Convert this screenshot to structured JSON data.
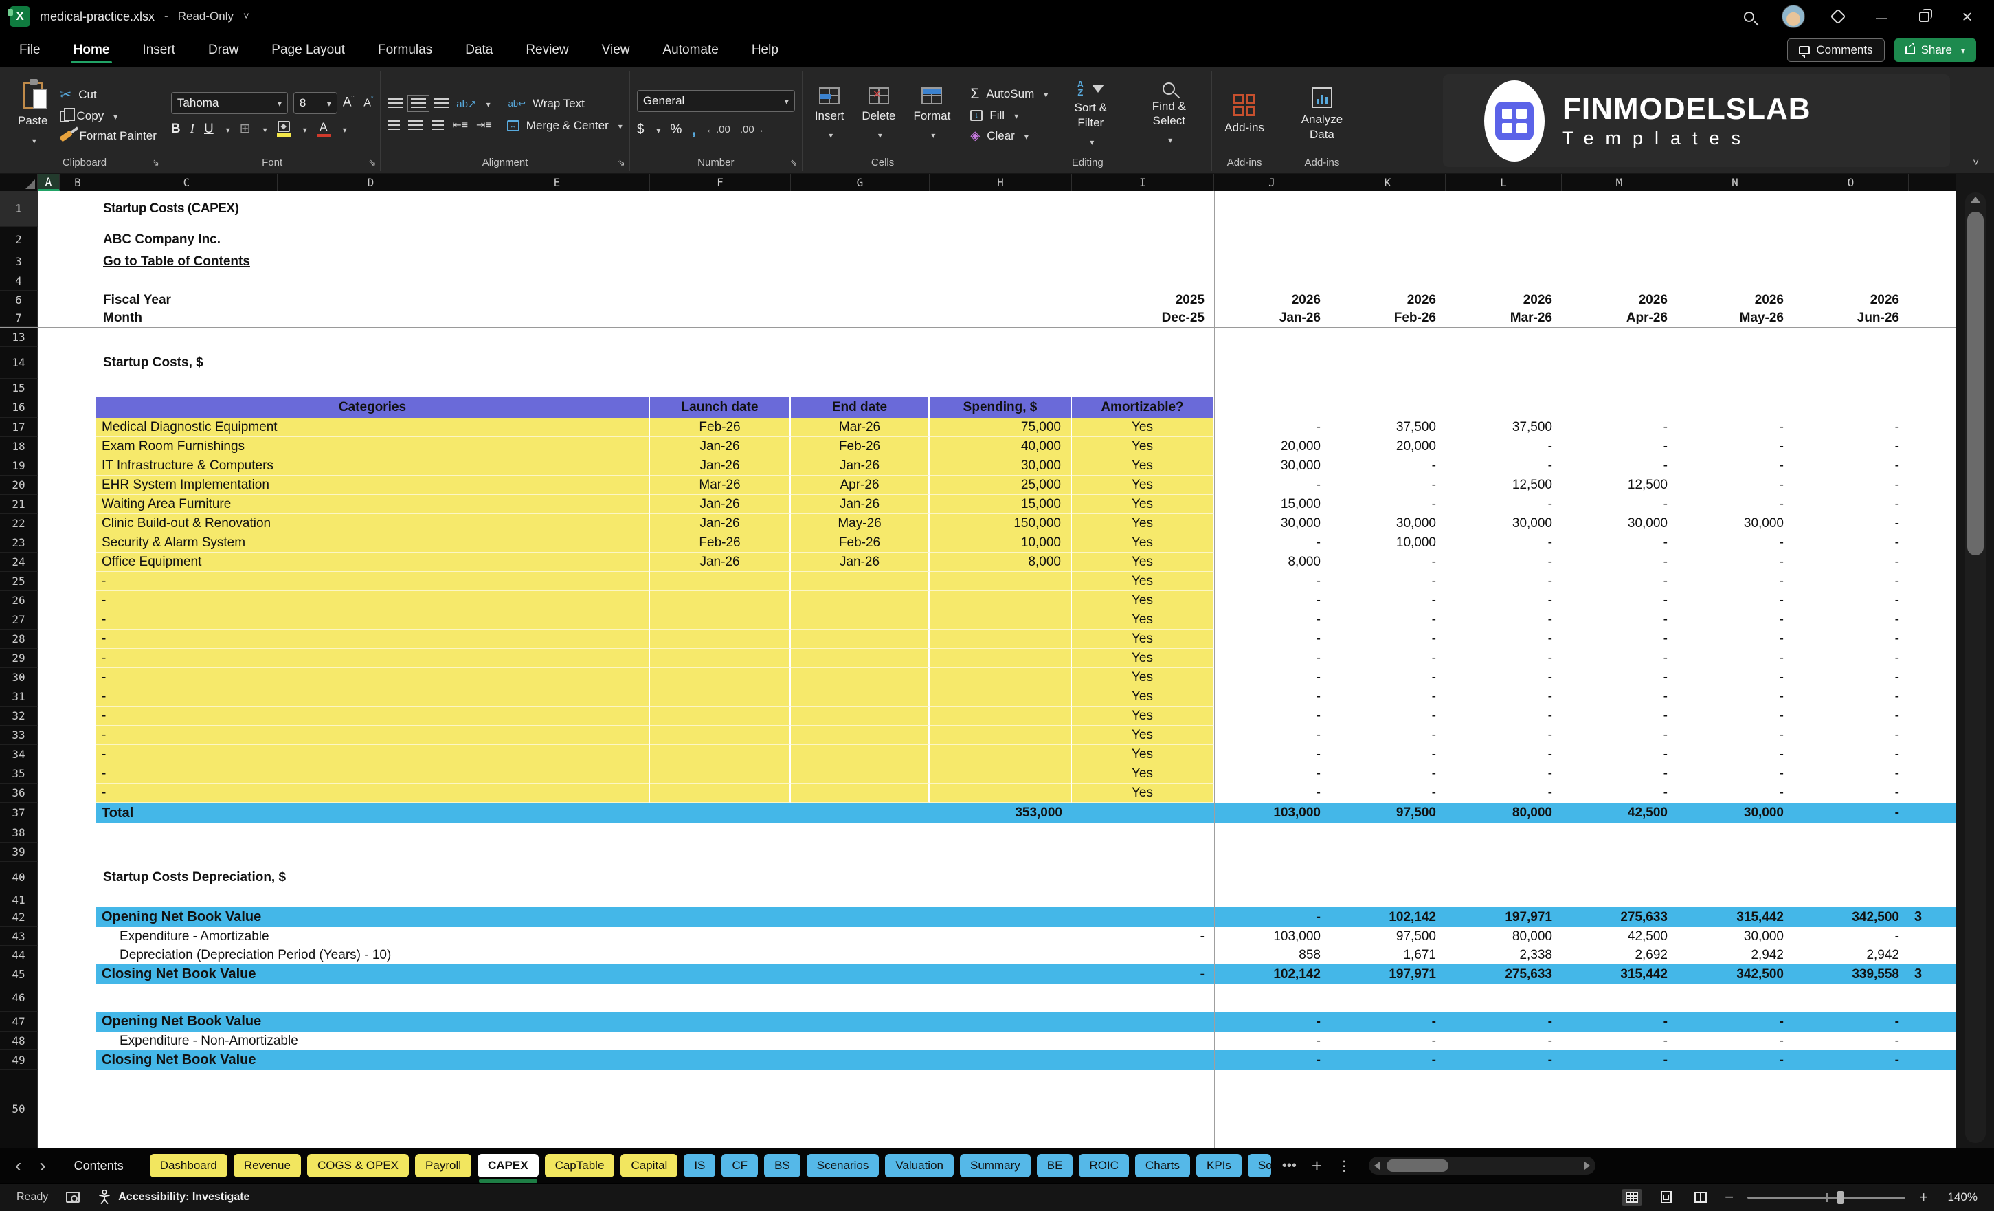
{
  "titlebar": {
    "filename": "medical-practice.xlsx",
    "separator": "-",
    "mode": "Read-Only"
  },
  "menubar": {
    "tabs": [
      "File",
      "Home",
      "Insert",
      "Draw",
      "Page Layout",
      "Formulas",
      "Data",
      "Review",
      "View",
      "Automate",
      "Help"
    ],
    "active_tab": "Home",
    "comments_label": "Comments",
    "share_label": "Share"
  },
  "ribbon": {
    "clipboard": {
      "label": "Clipboard",
      "paste": "Paste",
      "cut": "Cut",
      "copy": "Copy",
      "format_painter": "Format Painter"
    },
    "font": {
      "label": "Font",
      "font_name": "Tahoma",
      "font_size": "8",
      "bold": "B",
      "italic": "I",
      "underline": "U",
      "grow": "A",
      "shrink": "A"
    },
    "alignment": {
      "label": "Alignment",
      "orientation": "ab",
      "wrap_text": "Wrap Text",
      "merge_center": "Merge & Center"
    },
    "number": {
      "label": "Number",
      "format": "General",
      "currency": "$",
      "percent": "%",
      "comma": ",",
      "inc_decimal": "←.00",
      "dec_decimal": ".00→"
    },
    "cells": {
      "label": "Cells",
      "insert": "Insert",
      "delete": "Delete",
      "format": "Format"
    },
    "editing": {
      "label": "Editing",
      "autosum": "AutoSum",
      "sigma": "Σ",
      "fill": "Fill",
      "fill_arrow": "↓",
      "clear": "Clear",
      "clear_icon": "◈",
      "sort_a": "A",
      "sort_z": "Z",
      "sort_filter": "Sort & Filter",
      "find_select": "Find & Select"
    },
    "addins_group_label": "Add-ins",
    "addins": "Add-ins",
    "analyze_data": "Analyze Data",
    "logo": {
      "title": "FINMODELSLAB",
      "subtitle": "Templates"
    }
  },
  "sheet": {
    "column_letters": [
      "A",
      "B",
      "C",
      "D",
      "E",
      "F",
      "G",
      "H",
      "I",
      "J",
      "K",
      "L",
      "M",
      "N",
      "O"
    ],
    "row_numbers": [
      "1",
      "2",
      "3",
      "4",
      "6",
      "7",
      "13",
      "14",
      "15",
      "16",
      "17",
      "18",
      "19",
      "20",
      "21",
      "22",
      "23",
      "24",
      "25",
      "26",
      "27",
      "28",
      "29",
      "30",
      "31",
      "32",
      "33",
      "34",
      "35",
      "36",
      "37",
      "38",
      "39",
      "40",
      "41",
      "42",
      "43",
      "44",
      "45",
      "46",
      "47",
      "48",
      "49",
      "50"
    ],
    "title": "Startup Costs (CAPEX)",
    "company": "ABC Company Inc.",
    "toc_link": "Go to Table of Contents",
    "fiscal_year_label": "Fiscal Year",
    "month_label": "Month",
    "years": [
      "2025",
      "2026",
      "2026",
      "2026",
      "2026",
      "2026",
      "2026"
    ],
    "months": [
      "Dec-25",
      "Jan-26",
      "Feb-26",
      "Mar-26",
      "Apr-26",
      "May-26",
      "Jun-26"
    ],
    "costs": {
      "section_title": "Startup Costs, $",
      "headers": [
        "Categories",
        "Launch date",
        "End date",
        "Spending, $",
        "Amortizable?"
      ],
      "rows": [
        {
          "category": "Medical Diagnostic Equipment",
          "launch": "Feb-26",
          "end": "Mar-26",
          "spending": "75,000",
          "amortizable": "Yes",
          "monthly": [
            "-",
            "37,500",
            "37,500",
            "-",
            "-",
            "-"
          ]
        },
        {
          "category": "Exam Room Furnishings",
          "launch": "Jan-26",
          "end": "Feb-26",
          "spending": "40,000",
          "amortizable": "Yes",
          "monthly": [
            "20,000",
            "20,000",
            "-",
            "-",
            "-",
            "-"
          ]
        },
        {
          "category": "IT Infrastructure & Computers",
          "launch": "Jan-26",
          "end": "Jan-26",
          "spending": "30,000",
          "amortizable": "Yes",
          "monthly": [
            "30,000",
            "-",
            "-",
            "-",
            "-",
            "-"
          ]
        },
        {
          "category": "EHR System Implementation",
          "launch": "Mar-26",
          "end": "Apr-26",
          "spending": "25,000",
          "amortizable": "Yes",
          "monthly": [
            "-",
            "-",
            "12,500",
            "12,500",
            "-",
            "-"
          ]
        },
        {
          "category": "Waiting Area Furniture",
          "launch": "Jan-26",
          "end": "Jan-26",
          "spending": "15,000",
          "amortizable": "Yes",
          "monthly": [
            "15,000",
            "-",
            "-",
            "-",
            "-",
            "-"
          ]
        },
        {
          "category": "Clinic Build-out & Renovation",
          "launch": "Jan-26",
          "end": "May-26",
          "spending": "150,000",
          "amortizable": "Yes",
          "monthly": [
            "30,000",
            "30,000",
            "30,000",
            "30,000",
            "30,000",
            "-"
          ]
        },
        {
          "category": "Security & Alarm System",
          "launch": "Feb-26",
          "end": "Feb-26",
          "spending": "10,000",
          "amortizable": "Yes",
          "monthly": [
            "-",
            "10,000",
            "-",
            "-",
            "-",
            "-"
          ]
        },
        {
          "category": "Office Equipment",
          "launch": "Jan-26",
          "end": "Jan-26",
          "spending": "8,000",
          "amortizable": "Yes",
          "monthly": [
            "8,000",
            "-",
            "-",
            "-",
            "-",
            "-"
          ]
        }
      ],
      "empty_row": {
        "category": "-",
        "amortizable": "Yes",
        "monthly": [
          "-",
          "-",
          "-",
          "-",
          "-",
          "-"
        ]
      },
      "empty_row_count": 12,
      "total": {
        "label": "Total",
        "spending": "353,000",
        "monthly": [
          "103,000",
          "97,500",
          "80,000",
          "42,500",
          "30,000",
          "-"
        ]
      }
    },
    "depreciation": {
      "section_title": "Startup Costs Depreciation, $",
      "block1": [
        {
          "label": "Opening Net Book Value",
          "style": "band",
          "dec": "",
          "monthly": [
            "-",
            "102,142",
            "197,971",
            "275,633",
            "315,442",
            "342,500"
          ],
          "clipped": "3"
        },
        {
          "label": "Expenditure - Amortizable",
          "style": "plain",
          "dec": "-",
          "monthly": [
            "103,000",
            "97,500",
            "80,000",
            "42,500",
            "30,000",
            "-"
          ],
          "clipped": ""
        },
        {
          "label": "Depreciation (Depreciation Period (Years) - 10)",
          "style": "plain",
          "dec": "",
          "monthly": [
            "858",
            "1,671",
            "2,338",
            "2,692",
            "2,942",
            "2,942"
          ],
          "clipped": ""
        },
        {
          "label": "Closing Net Book Value",
          "style": "band",
          "dec": "-",
          "monthly": [
            "102,142",
            "197,971",
            "275,633",
            "315,442",
            "342,500",
            "339,558"
          ],
          "clipped": "3"
        }
      ],
      "block2": [
        {
          "label": "Opening Net Book Value",
          "style": "band",
          "dec": "",
          "monthly": [
            "-",
            "-",
            "-",
            "-",
            "-",
            "-"
          ],
          "clipped": ""
        },
        {
          "label": "Expenditure - Non-Amortizable",
          "style": "plain",
          "dec": "",
          "monthly": [
            "-",
            "-",
            "-",
            "-",
            "-",
            "-"
          ],
          "clipped": ""
        },
        {
          "label": "Closing Net Book Value",
          "style": "band",
          "dec": "",
          "monthly": [
            "-",
            "-",
            "-",
            "-",
            "-",
            "-"
          ],
          "clipped": ""
        }
      ]
    }
  },
  "sheet_tabs": [
    {
      "label": "Contents",
      "style": "plain"
    },
    {
      "label": "Dashboard",
      "style": "yellow"
    },
    {
      "label": "Revenue",
      "style": "yellow"
    },
    {
      "label": "COGS & OPEX",
      "style": "yellow"
    },
    {
      "label": "Payroll",
      "style": "yellow"
    },
    {
      "label": "CAPEX",
      "style": "active"
    },
    {
      "label": "CapTable",
      "style": "yellow"
    },
    {
      "label": "Capital",
      "style": "yellow"
    },
    {
      "label": "IS",
      "style": "blue"
    },
    {
      "label": "CF",
      "style": "blue"
    },
    {
      "label": "BS",
      "style": "blue"
    },
    {
      "label": "Scenarios",
      "style": "blue"
    },
    {
      "label": "Valuation",
      "style": "blue"
    },
    {
      "label": "Summary",
      "style": "blue"
    },
    {
      "label": "BE",
      "style": "blue"
    },
    {
      "label": "ROIC",
      "style": "blue"
    },
    {
      "label": "Charts",
      "style": "blue"
    },
    {
      "label": "KPIs",
      "style": "blue"
    },
    {
      "label": "So",
      "style": "blue-clipped"
    }
  ],
  "statusbar": {
    "ready": "Ready",
    "accessibility": "Accessibility: Investigate",
    "zoom_level": "140%"
  },
  "colors": {
    "table_header_blue": "#6A6AD9",
    "row_yellow": "#F6E96B",
    "band_blue": "#44B7E8",
    "tab_yellow": "#F2E65F",
    "tab_blue": "#55B8E8",
    "excel_green": "#21A366",
    "share_green": "#1D8A4E",
    "link_blue": "#2E62E9"
  }
}
